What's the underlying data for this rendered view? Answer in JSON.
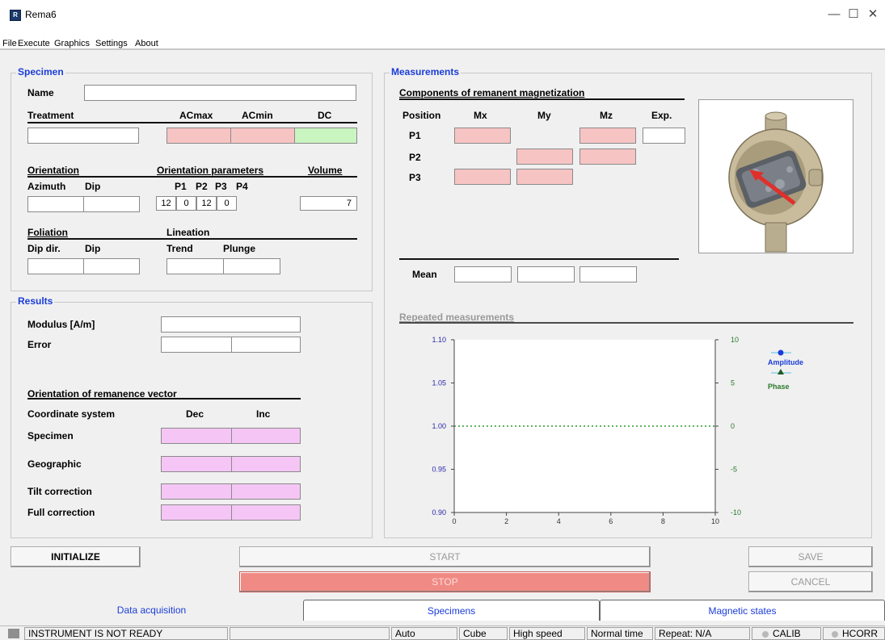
{
  "window": {
    "title": "Rema6",
    "icon_letter": "R"
  },
  "window_controls": {
    "minimize": "—",
    "maximize": "☐",
    "close": "✕"
  },
  "menu": [
    "File",
    "Execute",
    "Graphics",
    "Settings",
    "About"
  ],
  "specimen": {
    "group_title": "Specimen",
    "name_label": "Name",
    "name_value": "",
    "treatment_label": "Treatment",
    "acmax_label": "ACmax",
    "acmin_label": "ACmin",
    "dc_label": "DC",
    "orientation_label": "Orientation",
    "orientation_params_label": "Orientation parameters",
    "volume_label": "Volume",
    "azimuth_label": "Azimuth",
    "dip_label": "Dip",
    "p1_label": "P1",
    "p2_label": "P2",
    "p3_label": "P3",
    "p4_label": "P4",
    "p1": "12",
    "p2": "0",
    "p3": "12",
    "p4": "0",
    "volume": "7",
    "foliation_label": "Foliation",
    "lineation_label": "Lineation",
    "dipdir_label": "Dip dir.",
    "dip2_label": "Dip",
    "trend_label": "Trend",
    "plunge_label": "Plunge"
  },
  "results": {
    "group_title": "Results",
    "modulus_label": "Modulus [A/m]",
    "error_label": "Error",
    "orientation_label": "Orientation of remanence vector",
    "coord_label": "Coordinate system",
    "dec_label": "Dec",
    "inc_label": "Inc",
    "rows": [
      "Specimen",
      "Geographic",
      "Tilt correction",
      "Full correction"
    ]
  },
  "measurements": {
    "group_title": "Measurements",
    "components_label": "Components of remanent magnetization",
    "position_label": "Position",
    "mx_label": "Mx",
    "my_label": "My",
    "mz_label": "Mz",
    "exp_label": "Exp.",
    "positions": [
      "P1",
      "P2",
      "P3"
    ],
    "mean_label": "Mean",
    "repeated_label": "Repeated measurements"
  },
  "chart_data": {
    "type": "line",
    "xlim": [
      0,
      10
    ],
    "x_ticks": [
      "0",
      "2",
      "4",
      "6",
      "8",
      "10"
    ],
    "ylim": [
      0.9,
      1.1
    ],
    "y_ticks": [
      "1.10",
      "1.05",
      "1.00",
      "0.95",
      "0.90"
    ],
    "y2lim": [
      -10,
      10
    ],
    "y2_ticks": [
      "10",
      "5",
      "0",
      "-5",
      "-10"
    ],
    "grid": false,
    "legend_position": "right",
    "series": [
      {
        "name": "Amplitude",
        "values": [],
        "color": "#1a3dd8"
      },
      {
        "name": "Phase",
        "values": [],
        "color": "#2a7a2a"
      }
    ],
    "reference_line": {
      "y": 1.0,
      "style": "dotted",
      "color": "#2a9a2a"
    }
  },
  "buttons": {
    "initialize": "INITIALIZE",
    "start": "START",
    "stop": "STOP",
    "save": "SAVE",
    "cancel": "CANCEL"
  },
  "tabs": [
    "Data acquisition",
    "Specimens",
    "Magnetic states"
  ],
  "status": {
    "message": "INSTRUMENT IS NOT READY",
    "mode": "Auto",
    "shape": "Cube",
    "speed": "High speed",
    "time": "Normal time",
    "repeat": "Repeat: N/A",
    "calib": "CALIB",
    "hcorr": "HCORR"
  },
  "colors": {
    "group_title": "#1a3dd8",
    "pink_field": "#f7c4c4",
    "green_field": "#c9f5c0",
    "violet_field": "#f5c6f5",
    "stop_button": "#f08a84"
  }
}
